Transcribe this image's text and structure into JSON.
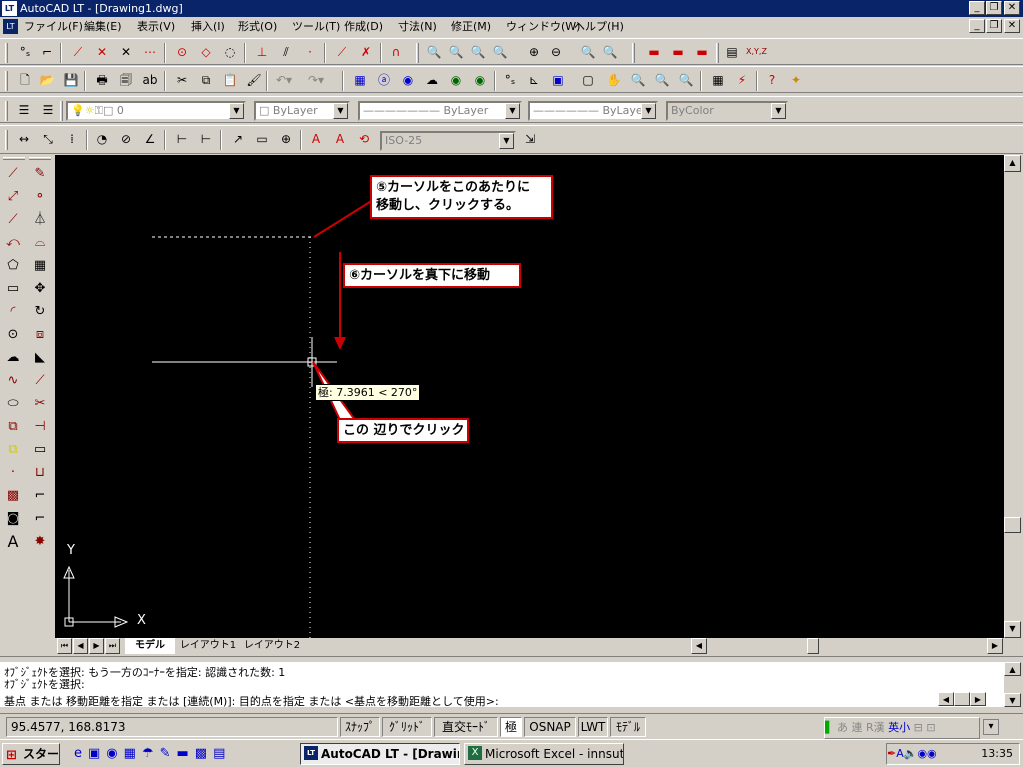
{
  "window": {
    "title": "AutoCAD LT - [Drawing1.dwg]",
    "app_icon": "LT"
  },
  "menu": {
    "items": [
      "ファイル(F)",
      "編集(E)",
      "表示(V)",
      "挿入(I)",
      "形式(O)",
      "ツール(T)",
      "作成(D)",
      "寸法(N)",
      "修正(M)",
      "ウィンドウ(W)",
      "ヘルプ(H)"
    ]
  },
  "layer_toolbar": {
    "layer_value": "0",
    "color_value": "ByLayer",
    "linetype_value": "ByLayer",
    "lineweight_value": "ByLayer",
    "plotstyle_value": "ByColor"
  },
  "dim_toolbar": {
    "dimstyle_value": "ISO-25"
  },
  "canvas": {
    "callout1": "⑤カーソルをこのあたりに移動し、クリックする。",
    "callout1_l1": "⑤カーソルをこのあたりに",
    "callout1_l2": "移動し、クリックする。",
    "callout2": "⑥カーソルを真下に移動",
    "callout3": "この 辺りでクリック",
    "tooltip": "極: 7.3961 < 270°",
    "ucs_y": "Y",
    "ucs_x": "X"
  },
  "tabs": [
    "モデル",
    "レイアウト1",
    "レイアウト2"
  ],
  "command": {
    "line1": "ｵﾌﾞｼﾞｪｸﾄを選択: もう一方のｺｰﾅｰを指定: 認識された数: 1",
    "line2": "ｵﾌﾞｼﾞｪｸﾄを選択:",
    "line3": "基点 または 移動距離を指定 または [連続(M)]: 目的点を指定 または <基点を移動距離として使用>:"
  },
  "status": {
    "coords": "95.4577, 168.8173",
    "snap": "ｽﾅｯﾌﾟ",
    "grid": "ｸﾞﾘｯﾄﾞ",
    "ortho": "直交ﾓｰﾄﾞ",
    "polar": "極",
    "osnap": "OSNAP",
    "lwt": "LWT",
    "model": "ﾓﾃﾞﾙ"
  },
  "taskbar": {
    "start": "スタート",
    "task1": "AutoCAD LT - [Drawing1.dwg]",
    "task2": "Microsoft Excel - innsut...",
    "clock": "13:35"
  }
}
